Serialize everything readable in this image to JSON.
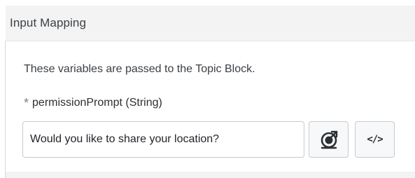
{
  "section": {
    "title": "Input Mapping",
    "description": "These variables are passed to the Topic Block."
  },
  "field": {
    "required_marker": "*",
    "label": "permissionPrompt (String)",
    "value": "Would you like to share your location?"
  },
  "buttons": {
    "resource_icon": "resource-picker-icon",
    "code_icon": "code-icon",
    "code_glyph": "</>"
  },
  "colors": {
    "header_bg": "#f3f3f3",
    "border": "#c7cbd0"
  }
}
